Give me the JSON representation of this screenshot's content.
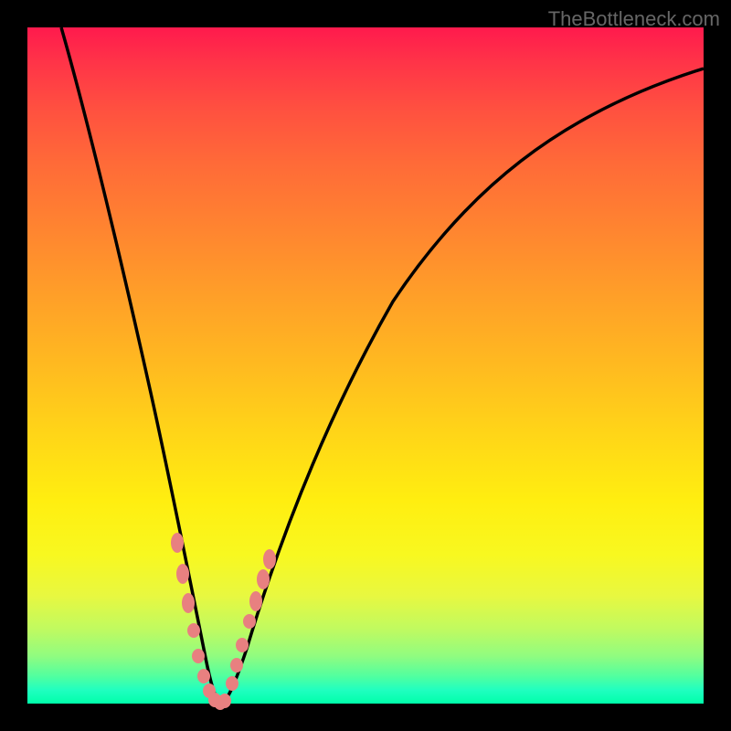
{
  "watermark": "TheBottleneck.com",
  "colors": {
    "background": "#000000",
    "gradient_top": "#ff1a4d",
    "gradient_bottom": "#00ffaa",
    "curve": "#000000",
    "marker_fill": "#e88080"
  },
  "chart_data": {
    "type": "line",
    "title": "",
    "xlabel": "",
    "ylabel": "",
    "xlim": [
      0,
      100
    ],
    "ylim": [
      0,
      100
    ],
    "series": [
      {
        "name": "bottleneck-curve",
        "x": [
          5,
          8,
          11,
          14,
          17,
          20,
          22,
          24,
          25.5,
          27,
          28.5,
          30,
          35,
          42,
          50,
          60,
          72,
          85,
          100
        ],
        "y": [
          100,
          87,
          74,
          61,
          48,
          35,
          24,
          14,
          7,
          2,
          0,
          3,
          15,
          30,
          45,
          58,
          70,
          80,
          88
        ]
      }
    ],
    "marker_points": {
      "name": "highlighted-range",
      "x": [
        22.2,
        23.0,
        23.8,
        24.6,
        25.3,
        26.0,
        26.8,
        27.7,
        28.5,
        29.2,
        30.3,
        31.0,
        31.8,
        32.8,
        33.8,
        34.8,
        35.8
      ],
      "y": [
        24,
        19,
        15,
        11,
        7,
        4,
        1.5,
        0.3,
        0,
        0.4,
        3,
        6,
        9,
        12,
        15,
        18,
        21
      ]
    },
    "annotations": []
  }
}
